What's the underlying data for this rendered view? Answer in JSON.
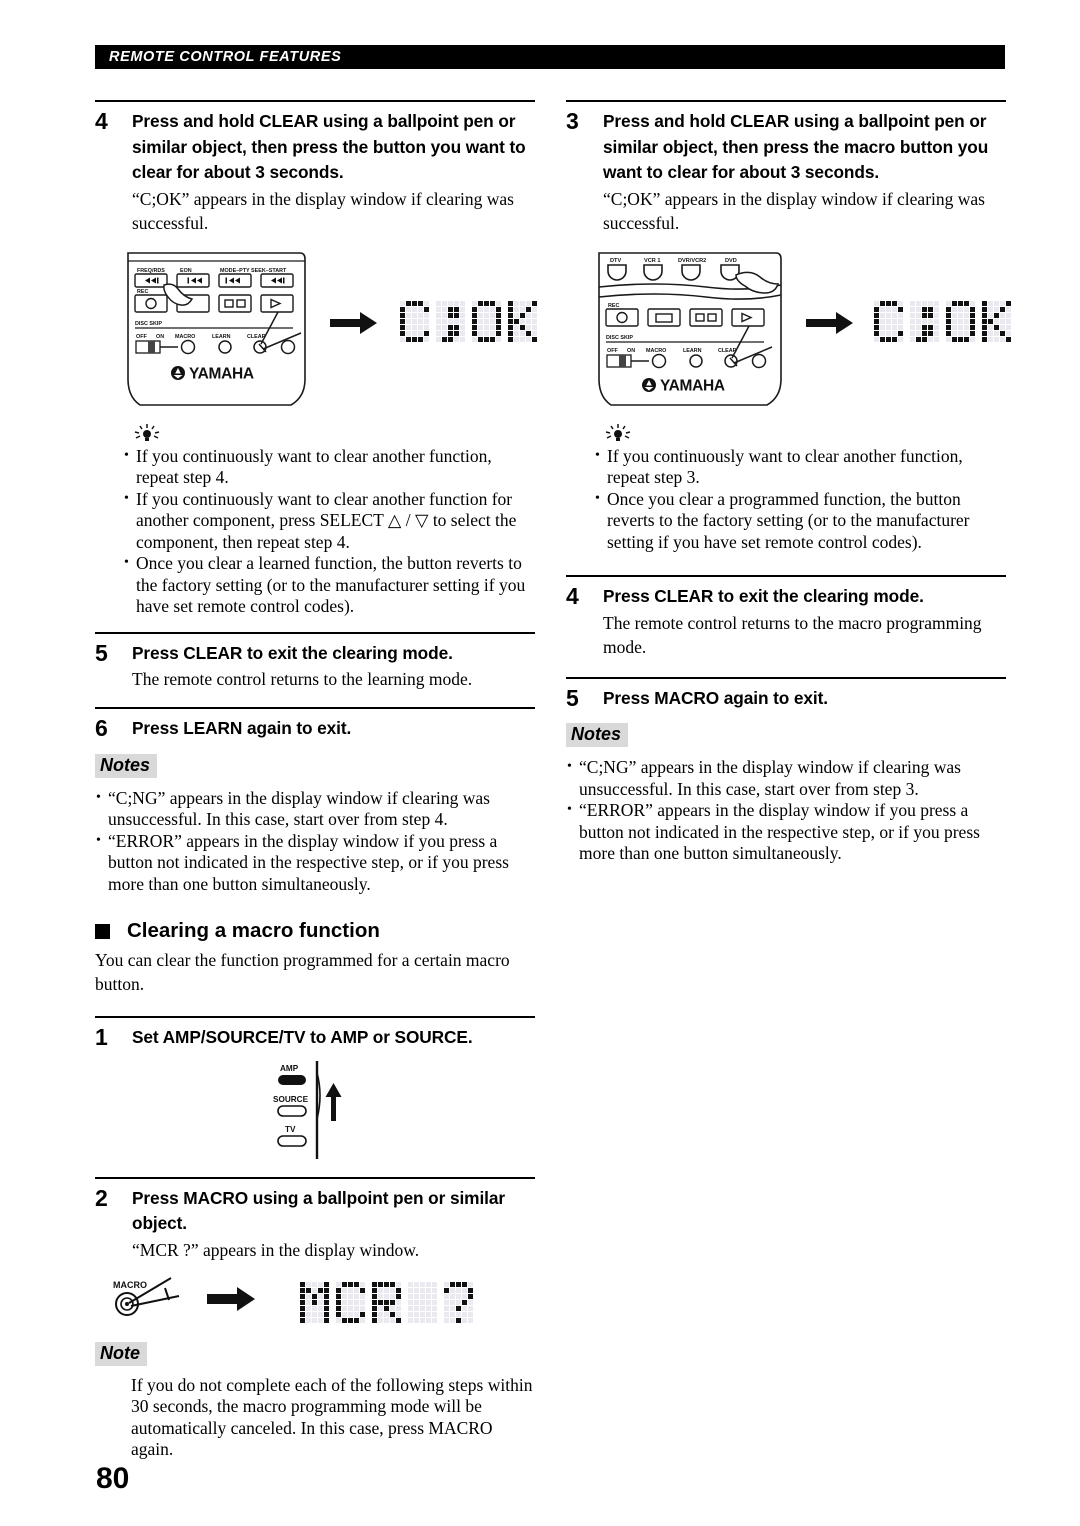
{
  "header": {
    "running_head": "REMOTE CONTROL FEATURES"
  },
  "page": {
    "number": "80"
  },
  "icons": {
    "tip": "tip-bulb-icon",
    "arrow": "right-arrow-icon",
    "section_bullet": "filled-square-icon"
  },
  "left_column": {
    "step4": {
      "number": "4",
      "title": "Press and hold CLEAR using a ballpoint pen or similar object, then press the button you want to clear for about 3 seconds.",
      "body": "“C;OK” appears in the display window if clearing was successful."
    },
    "remote_figure": {
      "name": "remote-control-learn-figure",
      "labels": {
        "freq_rds": "FREQ/RDS",
        "eon": "EON",
        "mode_pty_seek_start": "MODE–PTY SEEK–START",
        "rec": "REC",
        "disc_skip": "DISC SKIP",
        "off": "OFF",
        "on": "ON",
        "macro": "MACRO",
        "learn": "LEARN",
        "clear": "CLEAR",
        "brand": "YAMAHA"
      }
    },
    "display": {
      "text": "C;OK",
      "name": "lcd-display-cok"
    },
    "tips": [
      "If you continuously want to clear another function, repeat step 4.",
      "If you continuously want to clear another function for another component, press SELECT △ / ▽ to select the component, then repeat step 4.",
      "Once you clear a learned function, the button reverts to the factory setting (or to the manufacturer setting if you have set remote control codes)."
    ],
    "step5": {
      "number": "5",
      "title": "Press CLEAR to exit the clearing mode.",
      "body": "The remote control returns to the learning mode."
    },
    "step6": {
      "number": "6",
      "title": "Press LEARN again to exit."
    },
    "notes_label": "Notes",
    "notes": [
      "“C;NG” appears in the display window if clearing was unsuccessful. In this case, start over from step 4.",
      "“ERROR” appears in the display window if you press a button not indicated in the respective step, or if you press more than one button simultaneously."
    ],
    "section": {
      "title": "Clearing a macro function",
      "intro": "You can clear the function programmed for a certain macro button."
    },
    "step1": {
      "number": "1",
      "title": "Set AMP/SOURCE/TV to AMP or SOURCE."
    },
    "amp_switch": {
      "name": "amp-source-tv-switch-figure",
      "options": [
        "AMP",
        "SOURCE",
        "TV"
      ],
      "selected": "AMP"
    },
    "step2": {
      "number": "2",
      "title": "Press MACRO using a ballpoint pen or similar object.",
      "body": "“MCR ?” appears in the display window."
    },
    "macro_figure": {
      "name": "macro-button-figure",
      "label": "MACRO"
    },
    "macro_display": {
      "text": "MCR ?",
      "name": "lcd-display-mcr"
    },
    "note_label": "Note",
    "note_body": "If you do not complete each of the following steps within 30 seconds, the macro programming mode will be automatically canceled. In this case, press MACRO again."
  },
  "right_column": {
    "step3": {
      "number": "3",
      "title": "Press and hold CLEAR using a ballpoint pen or similar object, then press the macro button you want to clear for about 3 seconds.",
      "body": "“C;OK” appears in the display window if clearing was successful."
    },
    "remote_figure": {
      "name": "remote-control-macro-figure",
      "labels": {
        "dtv": "DTV",
        "vcr1": "VCR 1",
        "dvr_vcr2": "DVR/VCR2",
        "dvd": "DVD",
        "rec": "REC",
        "disc_skip": "DISC SKIP",
        "off": "OFF",
        "on": "ON",
        "macro": "MACRO",
        "learn": "LEARN",
        "clear": "CLEAR",
        "brand": "YAMAHA"
      }
    },
    "display": {
      "text": "C;OK",
      "name": "lcd-display-cok"
    },
    "tips": [
      "If you continuously want to clear another function, repeat step 3.",
      "Once you clear a programmed function, the button reverts to the factory setting (or to the manufacturer setting if you have set remote control codes)."
    ],
    "step4": {
      "number": "4",
      "title": "Press CLEAR to exit the clearing mode.",
      "body": "The remote control returns to the macro programming mode."
    },
    "step5": {
      "number": "5",
      "title": "Press MACRO again to exit."
    },
    "notes_label": "Notes",
    "notes": [
      "“C;NG” appears in the display window if clearing was unsuccessful. In this case, start over from step 3.",
      "“ERROR” appears in the display window if you press a button not indicated in the respective step, or if you press more than one button simultaneously."
    ]
  }
}
